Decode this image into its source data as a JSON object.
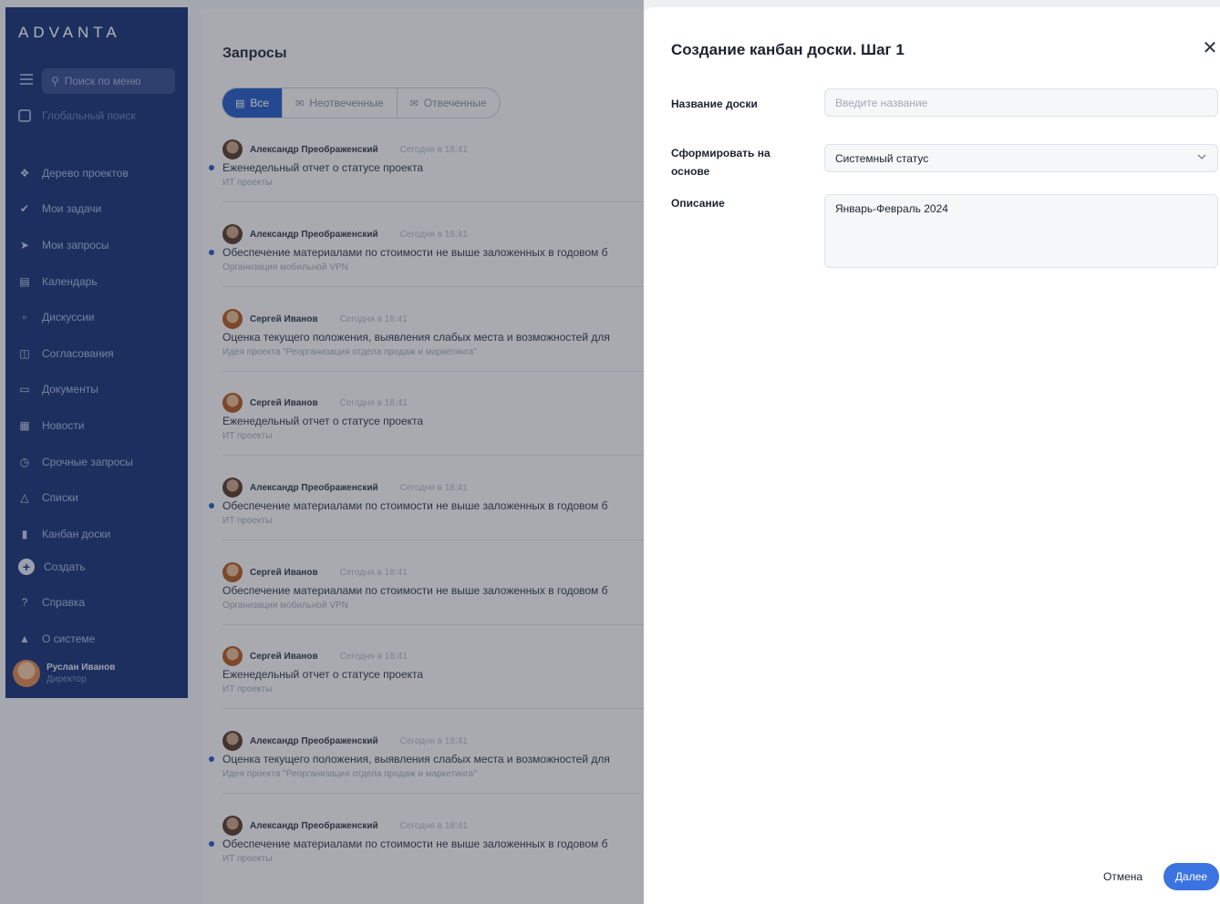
{
  "sidebar": {
    "logo": "ADVANTA",
    "search_placeholder": "Поиск по меню",
    "global_search": "Глобальный поиск",
    "items": [
      {
        "label": "Дерево проектов",
        "icon": "project-tree-icon"
      },
      {
        "label": "Мои задачи",
        "icon": "check-circle-icon"
      },
      {
        "label": "Мои запросы",
        "icon": "arrow-circle-icon"
      },
      {
        "label": "Календарь",
        "icon": "calendar-icon"
      },
      {
        "label": "Дискуссии",
        "icon": "chat-icon"
      },
      {
        "label": "Согласования",
        "icon": "book-icon"
      },
      {
        "label": "Документы",
        "icon": "document-icon"
      },
      {
        "label": "Новости",
        "icon": "news-icon"
      },
      {
        "label": "Срочные запросы",
        "icon": "clock-icon"
      },
      {
        "label": "Списки",
        "icon": "bell-icon"
      },
      {
        "label": "Канбан доски",
        "icon": "kanban-icon"
      }
    ],
    "bottom": [
      {
        "label": "Создать",
        "icon": "plus-icon"
      },
      {
        "label": "Справка",
        "icon": "help-icon"
      },
      {
        "label": "О системе",
        "icon": "info-icon"
      }
    ],
    "user": {
      "name": "Руслан Иванов",
      "role": "Директор"
    }
  },
  "content": {
    "title": "Запросы",
    "tabs": [
      {
        "label": "Все",
        "icon": "folder-icon",
        "active": true
      },
      {
        "label": "Неотвеченные",
        "icon": "mail-icon",
        "active": false
      },
      {
        "label": "Отвеченные",
        "icon": "mail-open-icon",
        "active": false
      }
    ],
    "requests": [
      {
        "author": "Александр Преображенский",
        "time": "Сегодня в 18:41",
        "title": "Еженедельный отчет о статусе проекта",
        "sub": "ИТ проекты",
        "unread": true
      },
      {
        "author": "Александр Преображенский",
        "time": "Сегодня в 18:41",
        "title": "Обеспечение материалами по стоимости не выше заложенных в годовом б",
        "sub": "Организация мобильной VPN",
        "unread": true
      },
      {
        "author": "Сергей Иванов",
        "time": "Сегодня в 18:41",
        "title": "Оценка текущего положения, выявления слабых места и возможностей для",
        "sub": "Идея проекта \"Реорганизация отдела продаж и маркетинга\"",
        "unread": false
      },
      {
        "author": "Сергей Иванов",
        "time": "Сегодня в 18:41",
        "title": "Еженедельный отчет о статусе проекта",
        "sub": "ИТ проекты",
        "unread": false
      },
      {
        "author": "Александр Преображенский",
        "time": "Сегодня в 18:41",
        "title": "Обеспечение материалами по стоимости не выше заложенных в годовом б",
        "sub": "ИТ проекты",
        "unread": true
      },
      {
        "author": "Сергей Иванов",
        "time": "Сегодня в 18:41",
        "title": "Обеспечение материалами по стоимости не выше заложенных в годовом б",
        "sub": "Организация мобильной VPN",
        "unread": false
      },
      {
        "author": "Сергей Иванов",
        "time": "Сегодня в 18:41",
        "title": "Еженедельный отчет о статусе проекта",
        "sub": "ИТ проекты",
        "unread": false
      },
      {
        "author": "Александр Преображенский",
        "time": "Сегодня в 18:41",
        "title": "Оценка текущего положения, выявления слабых места и возможностей для",
        "sub": "Идея проекта \"Реорганизация отдела продаж и маркетинга\"",
        "unread": true
      },
      {
        "author": "Александр Преображенский",
        "time": "Сегодня в 18:41",
        "title": "Обеспечение материалами по стоимости не выше заложенных в годовом б",
        "sub": "ИТ проекты",
        "unread": true
      }
    ]
  },
  "modal": {
    "title": "Создание канбан доски. Шаг 1",
    "fields": {
      "name_label": "Название доски",
      "name_value": "",
      "name_placeholder": "Введите название",
      "base_label_line1": "Сформировать на",
      "base_label_line2": "основе",
      "base_value": "Системный статус",
      "desc_label": "Описание",
      "desc_value": "Январь-Февраль 2024"
    },
    "cancel_label": "Отмена",
    "next_label": "Далее"
  },
  "colors": {
    "sidebar": "#1f3a7d",
    "accent": "#3b73e0",
    "overlay": "rgba(22,26,38,0.34)"
  }
}
